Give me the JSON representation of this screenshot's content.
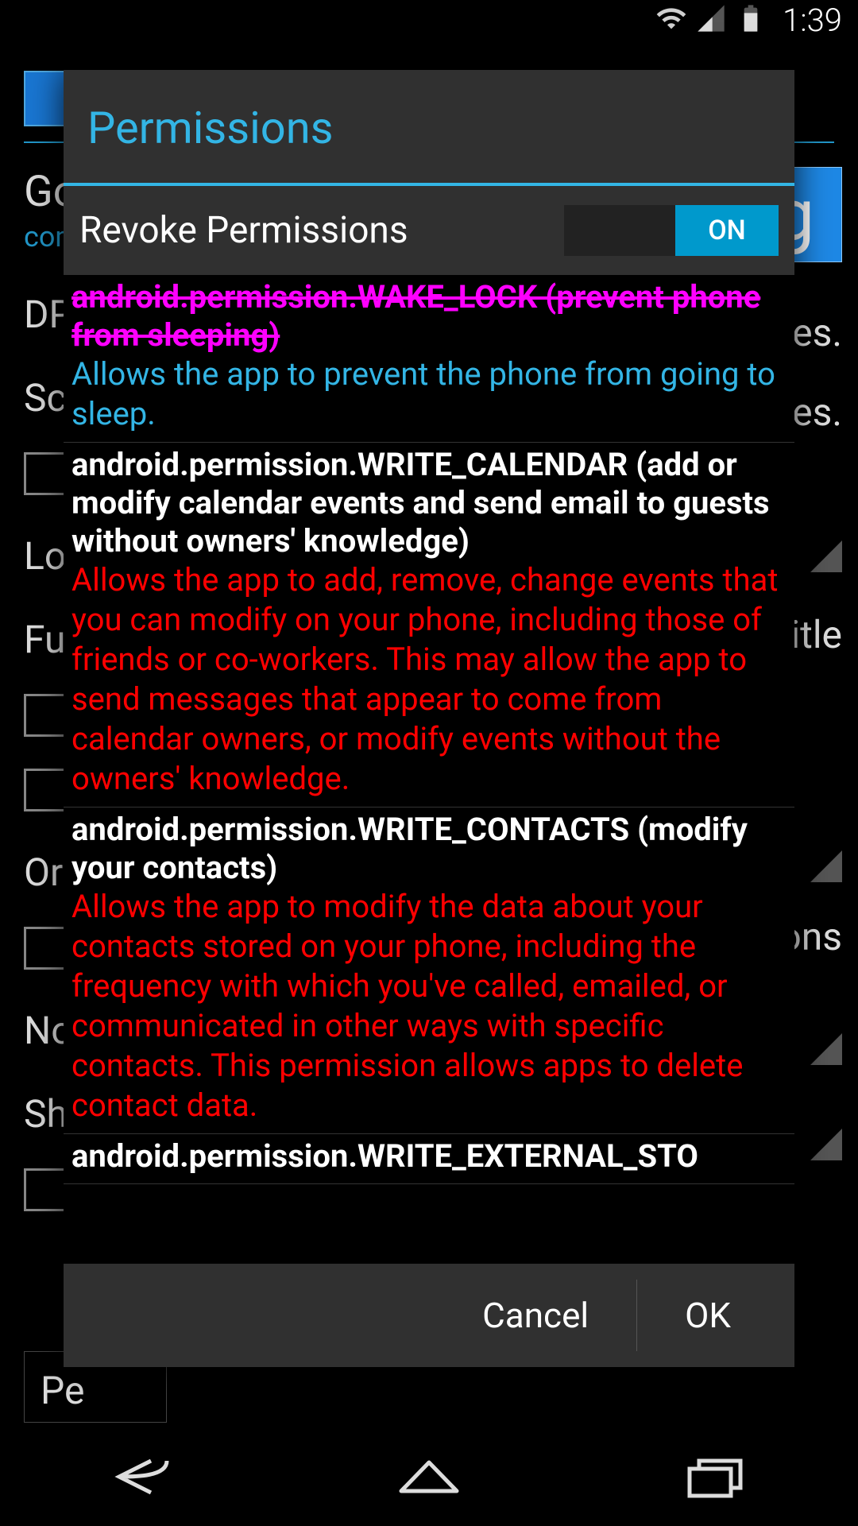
{
  "status": {
    "time": "1:39"
  },
  "bg": {
    "title": "Go",
    "sub": "com",
    "labels": [
      "DPI",
      "Scre",
      "Loca",
      "Fulls",
      "Orien",
      "Notif",
      "Show"
    ],
    "right": {
      "res1": "es.",
      "res2": "res.",
      "title": "title",
      "ons": "ons"
    },
    "gchar": "g",
    "btn": "Pe"
  },
  "dialog": {
    "title": "Permissions",
    "revoke_label": "Revoke Permissions",
    "toggle_state": "ON",
    "buttons": {
      "cancel": "Cancel",
      "ok": "OK"
    },
    "perms": [
      {
        "name": "android.permission.WAKE_LOCK (prevent phone from sleeping)",
        "desc": "Allows the app to prevent the phone from going to sleep.",
        "name_class": "revoked",
        "desc_class": "info"
      },
      {
        "name": "android.permission.WRITE_CALENDAR (add or modify calendar events and send email to guests without owners' knowledge)",
        "desc": "Allows the app to add, remove, change events that you can modify on your phone, including those of friends or co-workers. This may allow the app to send messages that appear to come from calendar owners, or modify events without the owners' knowledge.",
        "name_class": "normal",
        "desc_class": "danger"
      },
      {
        "name": "android.permission.WRITE_CONTACTS (modify your contacts)",
        "desc": "Allows the app to modify the data about your contacts stored on your phone, including the frequency with which you've called, emailed, or communicated in other ways with specific contacts. This permission allows apps to delete contact data.",
        "name_class": "normal",
        "desc_class": "danger"
      },
      {
        "name": "android.permission.WRITE_EXTERNAL_STO",
        "desc": "",
        "name_class": "normal",
        "desc_class": "danger"
      }
    ]
  }
}
